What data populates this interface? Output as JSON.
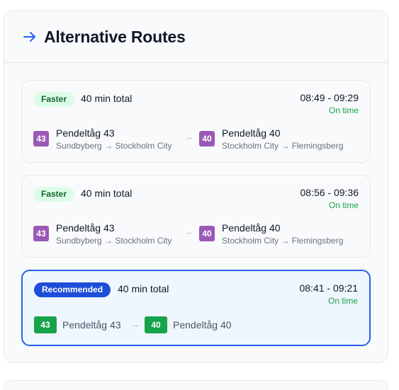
{
  "panel": {
    "title": "Alternative Routes",
    "icon": "arrow-right-icon",
    "accent": "#2563eb"
  },
  "routes": [
    {
      "badge": "Faster",
      "total": "40 min total",
      "times": "08:49 - 09:29",
      "status": "On time",
      "legs": [
        {
          "line": "43",
          "name": "Pendeltåg 43",
          "route": "Sundbyberg → Stockholm City"
        },
        {
          "line": "40",
          "name": "Pendeltåg 40",
          "route": "Stockholm City → Flemingsberg"
        }
      ],
      "separator": "→"
    },
    {
      "badge": "Faster",
      "total": "40 min total",
      "times": "08:56 - 09:36",
      "status": "On time",
      "legs": [
        {
          "line": "43",
          "name": "Pendeltåg 43",
          "route": "Sundbyberg → Stockholm City"
        },
        {
          "line": "40",
          "name": "Pendeltåg 40",
          "route": "Stockholm City → Flemingsberg"
        }
      ],
      "separator": "→"
    },
    {
      "badge": "Recommended",
      "total": "40 min total",
      "times": "08:41 - 09:21",
      "status": "On time",
      "legs": [
        {
          "line": "43",
          "name": "Pendeltåg 43"
        },
        {
          "line": "40",
          "name": "Pendeltåg 40"
        }
      ],
      "separator": "→"
    }
  ],
  "colors": {
    "line_purple": "#9b59b6",
    "line_green": "#16a34a",
    "on_time": "#16a34a",
    "recommended_border": "#2563eb"
  }
}
